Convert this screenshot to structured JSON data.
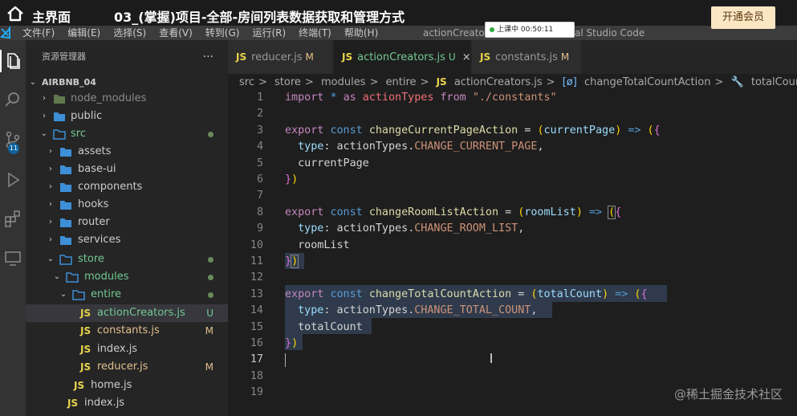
{
  "overlay": {
    "home_title": "主界面",
    "lesson_title": "03_(掌握)项目-全部-房间列表数据获取和管理方式",
    "vip_button": "开通会员"
  },
  "menubar": {
    "items": [
      "文件(F)",
      "编辑(E)",
      "选择(S)",
      "查看(V)",
      "转到(G)",
      "运行(R)",
      "终端(T)",
      "帮助(H)"
    ],
    "window_title_left": "actionCreators",
    "window_title_right": "al Studio Code",
    "recording": "上课中 00:50:11"
  },
  "sidebar": {
    "header": "资源管理器",
    "more": "···",
    "root": "AIRBNB_04",
    "items": [
      {
        "label": "node_modules"
      },
      {
        "label": "public"
      },
      {
        "label": "src"
      },
      {
        "label": "assets"
      },
      {
        "label": "base-ui"
      },
      {
        "label": "components"
      },
      {
        "label": "hooks"
      },
      {
        "label": "router"
      },
      {
        "label": "services"
      },
      {
        "label": "store"
      },
      {
        "label": "modules"
      },
      {
        "label": "entire"
      },
      {
        "label": "actionCreators.js",
        "badge": "U"
      },
      {
        "label": "constants.js",
        "badge": "M"
      },
      {
        "label": "index.js"
      },
      {
        "label": "reducer.js",
        "badge": "M"
      },
      {
        "label": "home.js"
      },
      {
        "label": "index.js"
      }
    ]
  },
  "tabs": [
    {
      "icon": "JS",
      "label": "reducer.js",
      "status": "M"
    },
    {
      "icon": "JS",
      "label": "actionCreators.js",
      "status": "U",
      "close": "×"
    },
    {
      "icon": "JS",
      "label": "constants.js",
      "status": "M"
    }
  ],
  "breadcrumb": {
    "parts": [
      "src",
      "store",
      "modules",
      "entire"
    ],
    "file_icon": "JS",
    "file": "actionCreators.js",
    "symbol_icon": "[ø]",
    "symbol": "changeTotalCountAction",
    "prop": "totalCount",
    "sep": ">"
  },
  "editor": {
    "line_numbers": [
      "1",
      "2",
      "3",
      "4",
      "5",
      "6",
      "7",
      "8",
      "9",
      "10",
      "11",
      "12",
      "13",
      "14",
      "15",
      "16",
      "17",
      "18",
      "19"
    ],
    "current_line": "17"
  },
  "watermark": "@稀土掘金技术社区",
  "colors": {
    "accent": "#007acc",
    "keyword": "#c586c0",
    "storage": "#569cd6",
    "function": "#dcdcaa",
    "string": "#ce9178",
    "constant": "#4fc1ff"
  }
}
